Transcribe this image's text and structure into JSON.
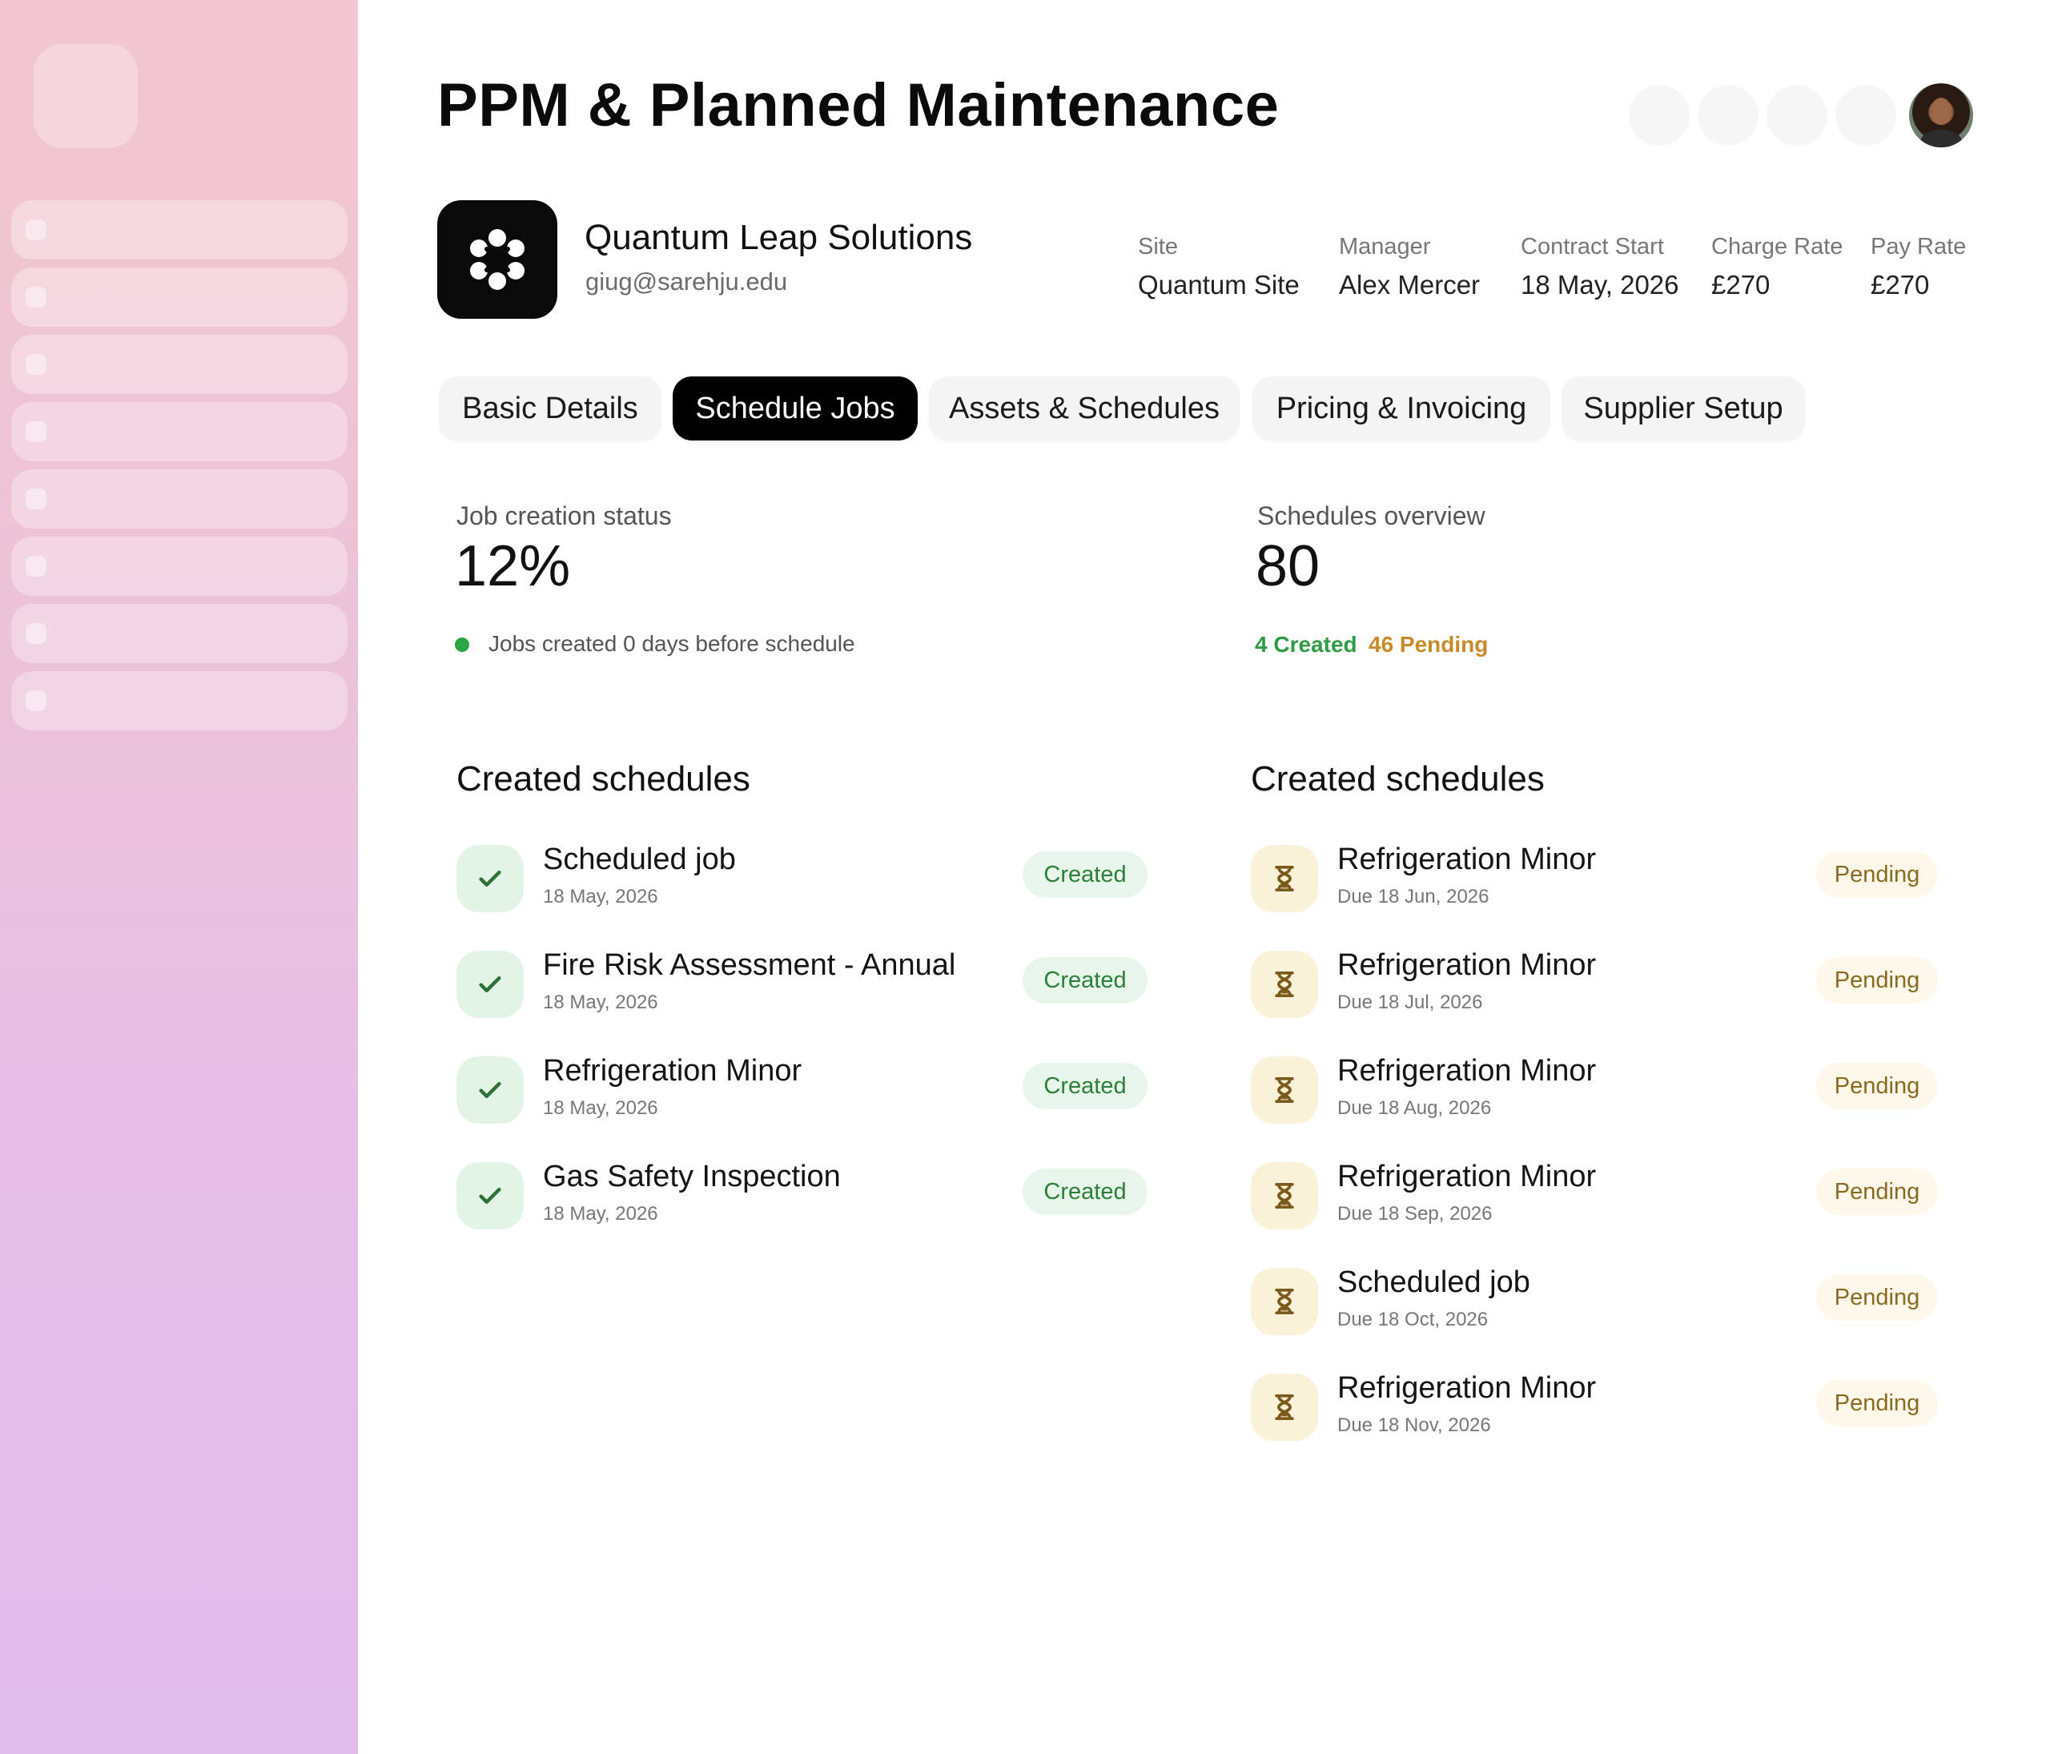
{
  "sidebar": {
    "item_count": 8
  },
  "header": {
    "title": "PPM & Planned Maintenance"
  },
  "client": {
    "name": "Quantum Leap Solutions",
    "email": "giug@sarehju.edu",
    "meta": [
      {
        "label": "Site",
        "value": "Quantum Site"
      },
      {
        "label": "Manager",
        "value": "Alex Mercer"
      },
      {
        "label": "Contract Start",
        "value": "18 May, 2026"
      },
      {
        "label": "Charge Rate",
        "value": "£270"
      },
      {
        "label": "Pay Rate",
        "value": "£270"
      }
    ]
  },
  "tabs": [
    {
      "label": "Basic Details",
      "active": false
    },
    {
      "label": "Schedule Jobs",
      "active": true
    },
    {
      "label": "Assets & Schedules",
      "active": false
    },
    {
      "label": "Pricing & Invoicing",
      "active": false
    },
    {
      "label": "Supplier Setup",
      "active": false
    }
  ],
  "stats": {
    "job_creation": {
      "label": "Job creation status",
      "value": "12%",
      "note": "Jobs created 0 days before schedule"
    },
    "schedules_overview": {
      "label": "Schedules overview",
      "value": "80",
      "created": "4 Created",
      "pending": "46 Pending"
    }
  },
  "created_list": {
    "title": "Created schedules",
    "items": [
      {
        "title": "Scheduled job",
        "date": "18 May, 2026",
        "status": "Created"
      },
      {
        "title": "Fire Risk Assessment - Annual",
        "date": "18 May, 2026",
        "status": "Created"
      },
      {
        "title": "Refrigeration Minor",
        "date": "18 May, 2026",
        "status": "Created"
      },
      {
        "title": "Gas Safety Inspection",
        "date": "18 May, 2026",
        "status": "Created"
      }
    ]
  },
  "pending_list": {
    "title": "Created schedules",
    "items": [
      {
        "title": "Refrigeration Minor",
        "date": "Due 18 Jun, 2026",
        "status": "Pending"
      },
      {
        "title": "Refrigeration Minor",
        "date": "Due 18 Jul, 2026",
        "status": "Pending"
      },
      {
        "title": "Refrigeration Minor",
        "date": "Due 18 Aug, 2026",
        "status": "Pending"
      },
      {
        "title": "Refrigeration Minor",
        "date": "Due 18 Sep, 2026",
        "status": "Pending"
      },
      {
        "title": "Scheduled job",
        "date": "Due 18 Oct, 2026",
        "status": "Pending"
      },
      {
        "title": "Refrigeration Minor",
        "date": "Due 18 Nov, 2026",
        "status": "Pending"
      }
    ]
  },
  "colors": {
    "accent_green": "#2e9b45",
    "accent_amber": "#c88b2a",
    "active_tab": "#000000"
  }
}
